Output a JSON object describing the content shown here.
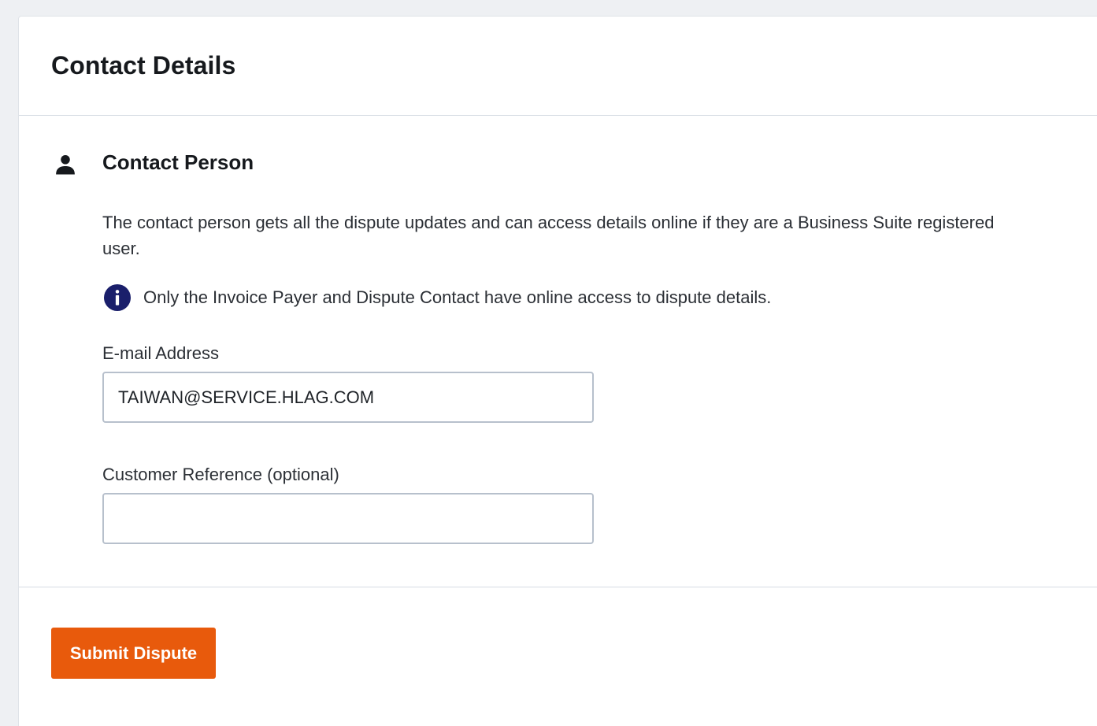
{
  "header": {
    "title": "Contact Details"
  },
  "contact_person": {
    "icon": "person-icon",
    "title": "Contact Person",
    "description": "The contact person gets all the dispute updates and can access details online if they are a Business Suite registered user.",
    "info": {
      "icon": "info-icon",
      "text": "Only the Invoice Payer and Dispute Contact have online access to dispute details."
    },
    "email": {
      "label": "E-mail Address",
      "value": "TAIWAN@SERVICE.HLAG.COM",
      "placeholder": ""
    },
    "customer_reference": {
      "label": "Customer Reference (optional)",
      "value": "",
      "placeholder": ""
    }
  },
  "footer": {
    "submit_label": "Submit Dispute"
  },
  "colors": {
    "accent": "#e85a0c",
    "info_icon": "#1a1f6b",
    "background": "#eef0f3"
  }
}
